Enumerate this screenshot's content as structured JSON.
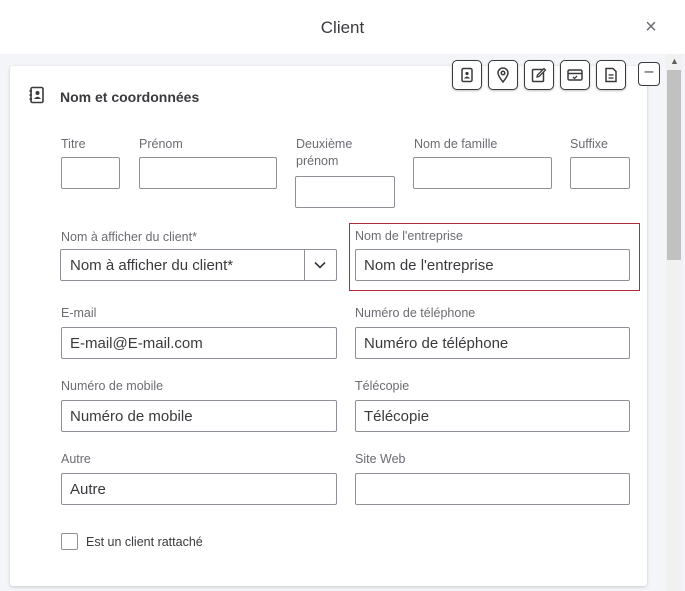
{
  "dialog": {
    "title": "Client",
    "close_symbol": "×"
  },
  "section": {
    "title": "Nom et coordonnées"
  },
  "toolbar": {
    "icons": [
      "contact-card-icon",
      "location-pin-icon",
      "edit-note-icon",
      "payment-card-icon",
      "document-icon"
    ],
    "collapse_symbol": "–"
  },
  "fields": {
    "titre": {
      "label": "Titre",
      "value": ""
    },
    "prenom": {
      "label": "Prénom",
      "value": ""
    },
    "deuxieme_prenom": {
      "label_line1": "Deuxième",
      "label_line2": "prénom",
      "value": ""
    },
    "nom_famille": {
      "label": "Nom de famille",
      "value": ""
    },
    "suffixe": {
      "label": "Suffixe",
      "value": ""
    },
    "nom_afficher": {
      "label": "Nom à afficher du client*",
      "value": "Nom à afficher du client*"
    },
    "entreprise": {
      "label": "Nom de l'entreprise",
      "placeholder": "Nom de l'entreprise"
    },
    "email": {
      "label": "E-mail",
      "placeholder": "E-mail@E-mail.com"
    },
    "telephone": {
      "label": "Numéro de téléphone",
      "placeholder": "Numéro de téléphone"
    },
    "mobile": {
      "label": "Numéro de mobile",
      "placeholder": "Numéro de mobile"
    },
    "telecopie": {
      "label": "Télécopie",
      "placeholder": "Télécopie"
    },
    "autre": {
      "label": "Autre",
      "placeholder": "Autre"
    },
    "site_web": {
      "label": "Site Web",
      "placeholder": ""
    }
  },
  "checkbox": {
    "label": "Est un client rattaché",
    "checked": false
  }
}
